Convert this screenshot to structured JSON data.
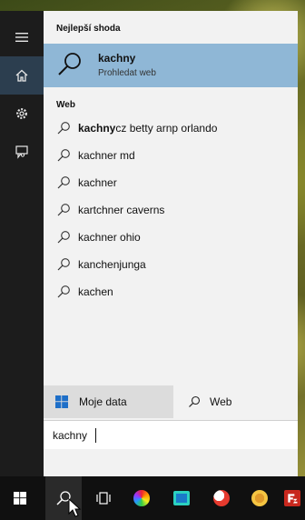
{
  "colors": {
    "rail_bg": "#1c1c1c",
    "panel_bg": "#f2f2f2",
    "highlight": "#8fb7d6",
    "taskbar_bg": "#101010"
  },
  "rail": {
    "items": [
      {
        "name": "hamburger-menu-icon"
      },
      {
        "name": "home-icon",
        "active": true
      },
      {
        "name": "settings-gear-icon"
      },
      {
        "name": "feedback-icon"
      }
    ]
  },
  "panel": {
    "best_match_heading": "Nejlepší shoda",
    "best_match": {
      "title": "kachny",
      "subtitle": "Prohledat web",
      "icon": "search-icon"
    },
    "web_heading": "Web",
    "web_results": [
      {
        "bold": "kachny",
        "rest": "cz betty arnp orlando"
      },
      {
        "bold": "",
        "rest": "kachner md"
      },
      {
        "bold": "",
        "rest": "kachner"
      },
      {
        "bold": "",
        "rest": "kartchner caverns"
      },
      {
        "bold": "",
        "rest": "kachner ohio"
      },
      {
        "bold": "",
        "rest": "kanchenjunga"
      },
      {
        "bold": "",
        "rest": "kachen"
      }
    ]
  },
  "filters": {
    "my_data_label": "Moje data",
    "web_label": "Web"
  },
  "search": {
    "value": "kachny"
  },
  "taskbar": {
    "items": [
      "start-icon",
      "search-icon",
      "task-view-icon",
      "app-icon-1",
      "app-icon-2",
      "app-icon-3",
      "app-icon-4",
      "filezilla-icon"
    ]
  }
}
